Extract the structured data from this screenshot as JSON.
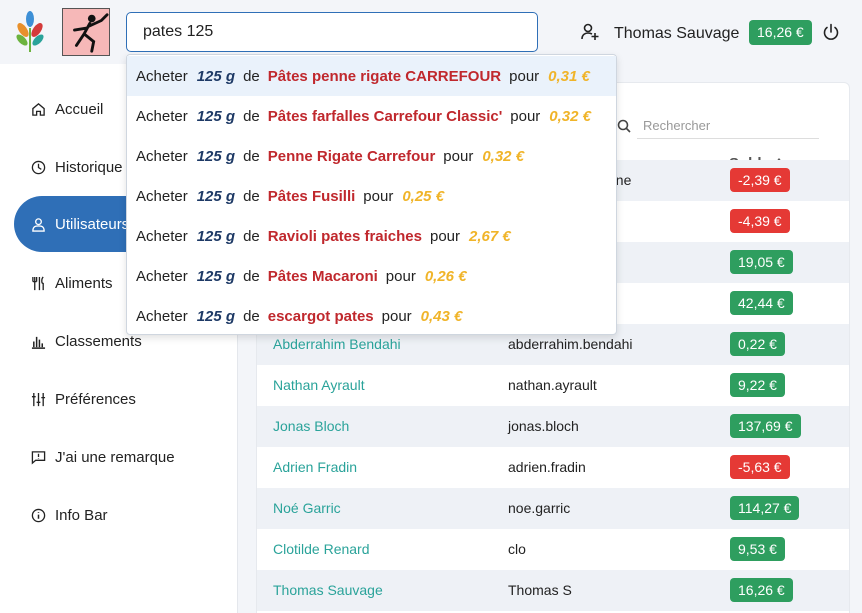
{
  "header": {
    "search_value": "pates 125",
    "user_name": "Thomas Sauvage",
    "user_balance": "16,26 €",
    "icons": {
      "logo": "leaf-logo-icon",
      "fencer": "fencer-logo-icon",
      "add_user": "add-user-icon",
      "power": "power-icon"
    }
  },
  "sidebar": {
    "items": [
      {
        "label": "Accueil",
        "icon": "home-icon"
      },
      {
        "label": "Historique",
        "icon": "clock-icon"
      },
      {
        "label": "Utilisateurs",
        "icon": "user-icon",
        "active": true
      },
      {
        "label": "Aliments",
        "icon": "utensils-icon"
      },
      {
        "label": "Classements",
        "icon": "bar-chart-icon"
      },
      {
        "label": "Préférences",
        "icon": "sliders-icon"
      },
      {
        "label": "J'ai une remarque",
        "icon": "comment-icon"
      },
      {
        "label": "Info Bar",
        "icon": "info-icon"
      }
    ]
  },
  "dropdown": {
    "verb": "Acheter",
    "qty": "125 g",
    "de": "de",
    "pour": "pour",
    "items": [
      {
        "product": "Pâtes penne rigate CARREFOUR",
        "price": "0,31 €"
      },
      {
        "product": "Pâtes farfalles Carrefour Classic'",
        "price": "0,32 €"
      },
      {
        "product": "Penne Rigate Carrefour",
        "price": "0,32 €"
      },
      {
        "product": "Pâtes Fusilli",
        "price": "0,25 €"
      },
      {
        "product": "Ravioli pates fraiches",
        "price": "2,67 €"
      },
      {
        "product": "Pâtes Macaroni",
        "price": "0,26 €"
      },
      {
        "product": "escargot pates",
        "price": "0,43 €"
      }
    ]
  },
  "table": {
    "search_placeholder": "Rechercher",
    "balance_header": "Solde",
    "rows": [
      {
        "name": "",
        "login": "ene",
        "balance": "-2,39 €",
        "status": "negative"
      },
      {
        "name": "",
        "login": "",
        "balance": "-4,39 €",
        "status": "negative"
      },
      {
        "name": "",
        "login": "",
        "balance": "19,05 €",
        "status": "positive"
      },
      {
        "name": "",
        "login": "",
        "balance": "42,44 €",
        "status": "positive"
      },
      {
        "name": "Abderrahim Bendahi",
        "login": "abderrahim.bendahi",
        "balance": "0,22 €",
        "status": "positive"
      },
      {
        "name": "Nathan Ayrault",
        "login": "nathan.ayrault",
        "balance": "9,22 €",
        "status": "positive"
      },
      {
        "name": "Jonas Bloch",
        "login": "jonas.bloch",
        "balance": "137,69 €",
        "status": "positive"
      },
      {
        "name": "Adrien Fradin",
        "login": "adrien.fradin",
        "balance": "-5,63 €",
        "status": "negative"
      },
      {
        "name": "Noé Garric",
        "login": "noe.garric",
        "balance": "114,27 €",
        "status": "positive"
      },
      {
        "name": "Clotilde Renard",
        "login": "clo",
        "balance": "9,53 €",
        "status": "positive"
      },
      {
        "name": "Thomas Sauvage",
        "login": "Thomas S",
        "balance": "16,26 €",
        "status": "positive"
      }
    ]
  },
  "colors": {
    "primary": "#2f6fb7",
    "positive": "#2e9e5f",
    "negative": "#e53935",
    "link": "#2aa39a",
    "product": "#c0282d",
    "price": "#f0b429"
  }
}
